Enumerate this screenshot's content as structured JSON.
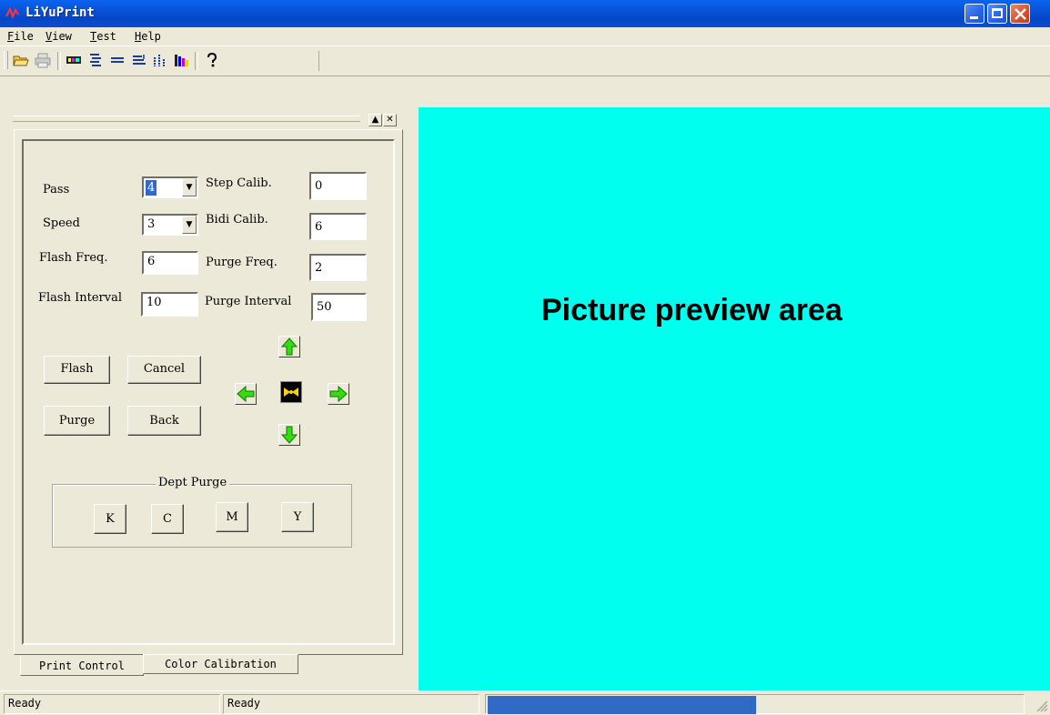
{
  "window": {
    "title": "LiYuPrint"
  },
  "menu": {
    "file": {
      "mnemonic": "F",
      "rest": "ile"
    },
    "view": {
      "mnemonic": "V",
      "rest": "iew"
    },
    "test": {
      "mnemonic": "T",
      "rest": "est"
    },
    "help": {
      "mnemonic": "H",
      "rest": "elp"
    }
  },
  "toolbar": {
    "icons": [
      "open-folder-icon",
      "print-icon",
      "color-bar-icon",
      "align-lines-icon",
      "horizontal-lines-icon",
      "step-lines-icon",
      "vertical-dots-icon",
      "color-columns-icon",
      "help-icon"
    ]
  },
  "panel": {
    "pass": {
      "label": "Pass",
      "value": "4"
    },
    "speed": {
      "label": "Speed",
      "value": "3"
    },
    "flash_freq": {
      "label": "Flash Freq.",
      "value": "6"
    },
    "flash_interval": {
      "label": "Flash Interval",
      "value": "10"
    },
    "step_calib": {
      "label": "Step Calib.",
      "value": "0"
    },
    "bidi_calib": {
      "label": "Bidi Calib.",
      "value": "6"
    },
    "purge_freq": {
      "label": "Purge Freq.",
      "value": "2"
    },
    "purge_interval": {
      "label": "Purge Interval",
      "value": "50"
    },
    "buttons": {
      "flash": "Flash",
      "cancel": "Cancel",
      "purge": "Purge",
      "back": "Back"
    },
    "dept_purge": {
      "title": "Dept Purge",
      "k": "K",
      "c": "C",
      "m": "M",
      "y": "Y"
    }
  },
  "tabs": {
    "print_control": "Print Control",
    "color_calibration": "Color Calibration"
  },
  "preview": {
    "text": "Picture preview area",
    "background": "#00ffee"
  },
  "status": {
    "pane1": "Ready",
    "pane2": "Ready",
    "progress_fraction": 0.5
  },
  "colors": {
    "title_blue": "#0852d8",
    "progress": "#316ac5",
    "arrow_green": "#33dd11"
  }
}
